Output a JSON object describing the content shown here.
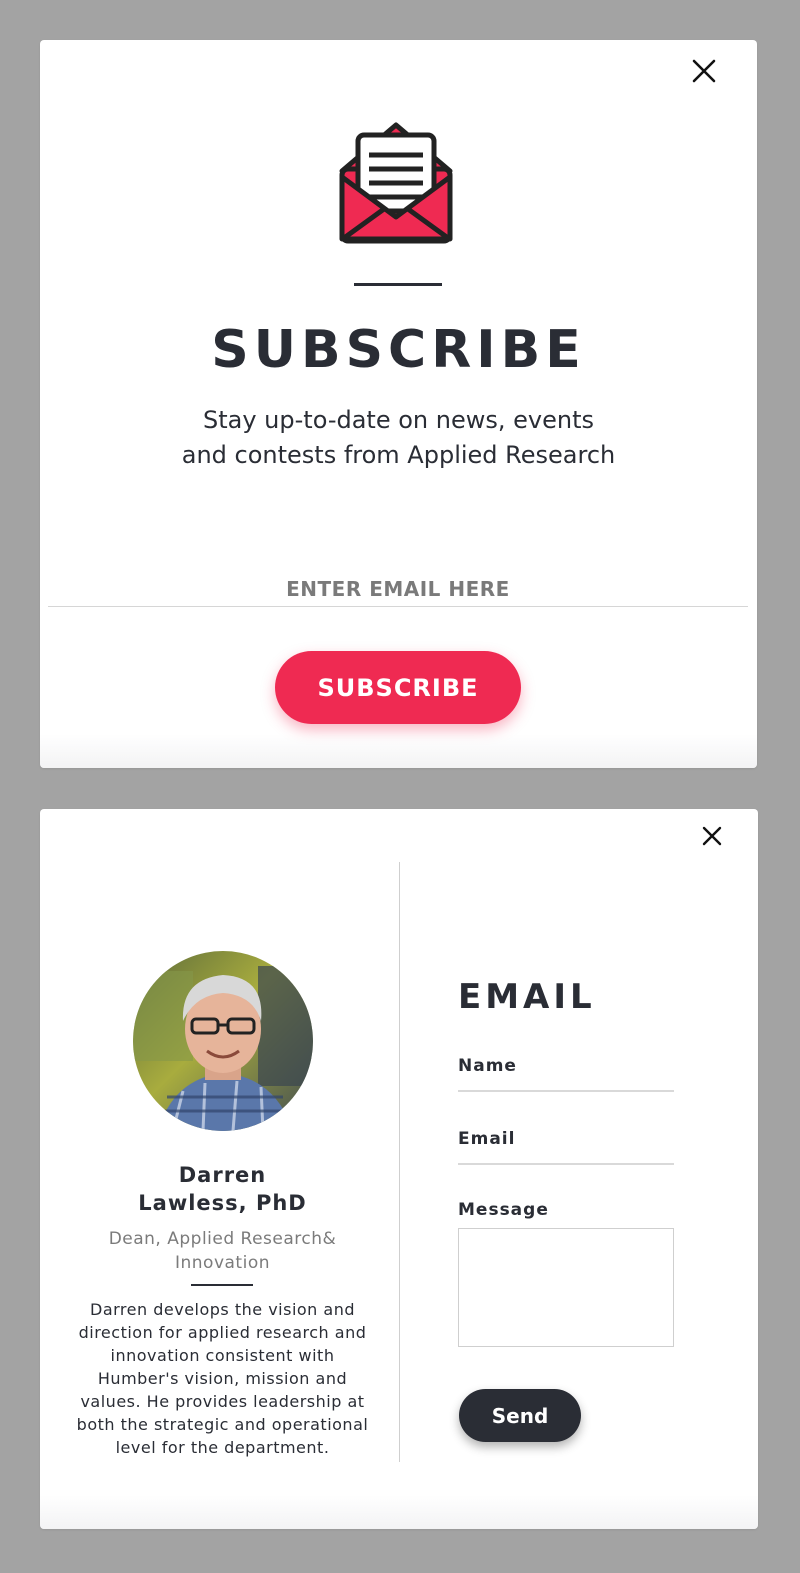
{
  "subscribe_modal": {
    "close_label": "×",
    "icon": "envelope-open-icon",
    "title": "SUBSCRIBE",
    "description_line1": "Stay up-to-date on news, events",
    "description_line2": "and contests from Applied Research",
    "email_placeholder": "ENTER EMAIL HERE",
    "email_value": "",
    "button_label": "SUBSCRIBE",
    "accent_color": "#ef2a52"
  },
  "contact_modal": {
    "close_icon": "close-icon",
    "person": {
      "name_line1": "Darren",
      "name_line2": "Lawless, PhD",
      "role_line1": "Dean, Applied Research&",
      "role_line2": "Innovation",
      "bio_lines": [
        "Darren develops the vision and",
        "direction for applied research and",
        "innovation consistent with",
        "Humber's vision, mission and",
        "values. He provides leadership at",
        "both the strategic and operational",
        "level for the department."
      ]
    },
    "form": {
      "title": "EMAIL",
      "name_label": "Name",
      "name_value": "",
      "email_label": "Email",
      "email_value": "",
      "message_label": "Message",
      "message_value": "",
      "send_label": "Send"
    },
    "dark_color": "#2a2d35"
  }
}
